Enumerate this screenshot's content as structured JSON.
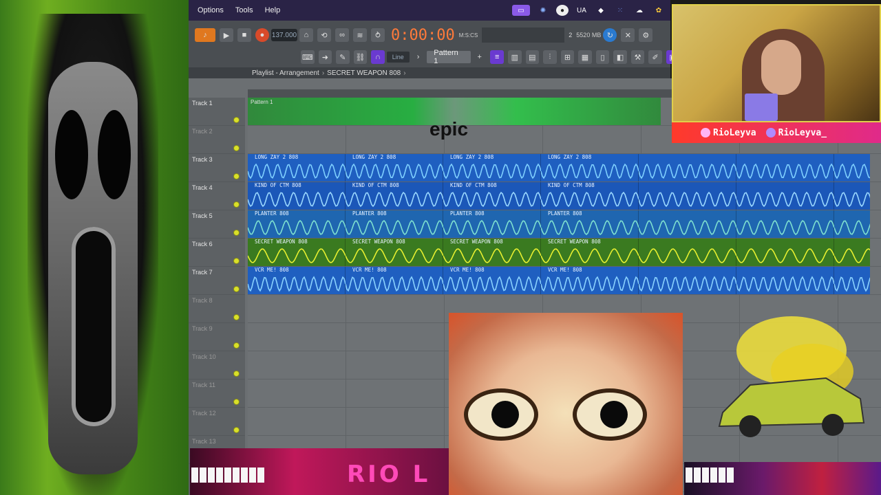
{
  "menu": {
    "items": [
      "Options",
      "Tools",
      "Help"
    ],
    "tray": [
      "UA"
    ]
  },
  "toolbar": {
    "tempo": "137.000",
    "time": "0:00:00",
    "time_unit": "M:S:CS",
    "memory": "5520 MB",
    "cpu_count": "2",
    "snap": "Line",
    "pattern": "Pattern 1"
  },
  "playlist": {
    "breadcrumb": [
      "Playlist - Arrangement",
      "SECRET WEAPON 808"
    ],
    "pattern_label": "Pattern 1",
    "tracks": [
      {
        "name": "Track 1",
        "active": true
      },
      {
        "name": "Track 2",
        "active": false
      },
      {
        "name": "Track 3",
        "active": true
      },
      {
        "name": "Track 4",
        "active": true
      },
      {
        "name": "Track 5",
        "active": true
      },
      {
        "name": "Track 6",
        "active": true
      },
      {
        "name": "Track 7",
        "active": true
      },
      {
        "name": "Track 8",
        "active": false
      },
      {
        "name": "Track 9",
        "active": false
      },
      {
        "name": "Track 10",
        "active": false
      },
      {
        "name": "Track 11",
        "active": false
      },
      {
        "name": "Track 12",
        "active": false
      },
      {
        "name": "Track 13",
        "active": false
      }
    ],
    "clips": [
      {
        "track_index": 2,
        "name": "LONG ZAY 2 808",
        "color": "#1f5fc0",
        "wave": "#7fd0ff",
        "freq": 9
      },
      {
        "track_index": 3,
        "name": "KIND OF CTM 808",
        "color": "#1b57b8",
        "wave": "#9ad8ff",
        "freq": 8
      },
      {
        "track_index": 4,
        "name": "PLANTER 808",
        "color": "#1f66b0",
        "wave": "#7ee0d0",
        "freq": 7
      },
      {
        "track_index": 5,
        "name": "SECRET WEAPON 808",
        "color": "#3a7a20",
        "wave": "#e8f030",
        "freq": 5
      },
      {
        "track_index": 6,
        "name": "VCR ME! 808",
        "color": "#1f5fc0",
        "wave": "#8ad2ff",
        "freq": 10
      }
    ]
  },
  "overlay": {
    "caption": "epic",
    "socials": [
      "RioLeyva",
      "RioLeyva_"
    ],
    "logo": "RIO L"
  },
  "colors": {
    "accent": "#6a3ad0",
    "menubar": "#2a2346",
    "time": "#ff7a3a"
  },
  "icons": [
    "play-icon",
    "stop-icon",
    "record-icon",
    "pattern-icon",
    "draw-icon",
    "link-icon",
    "settings-icon",
    "close-icon"
  ]
}
